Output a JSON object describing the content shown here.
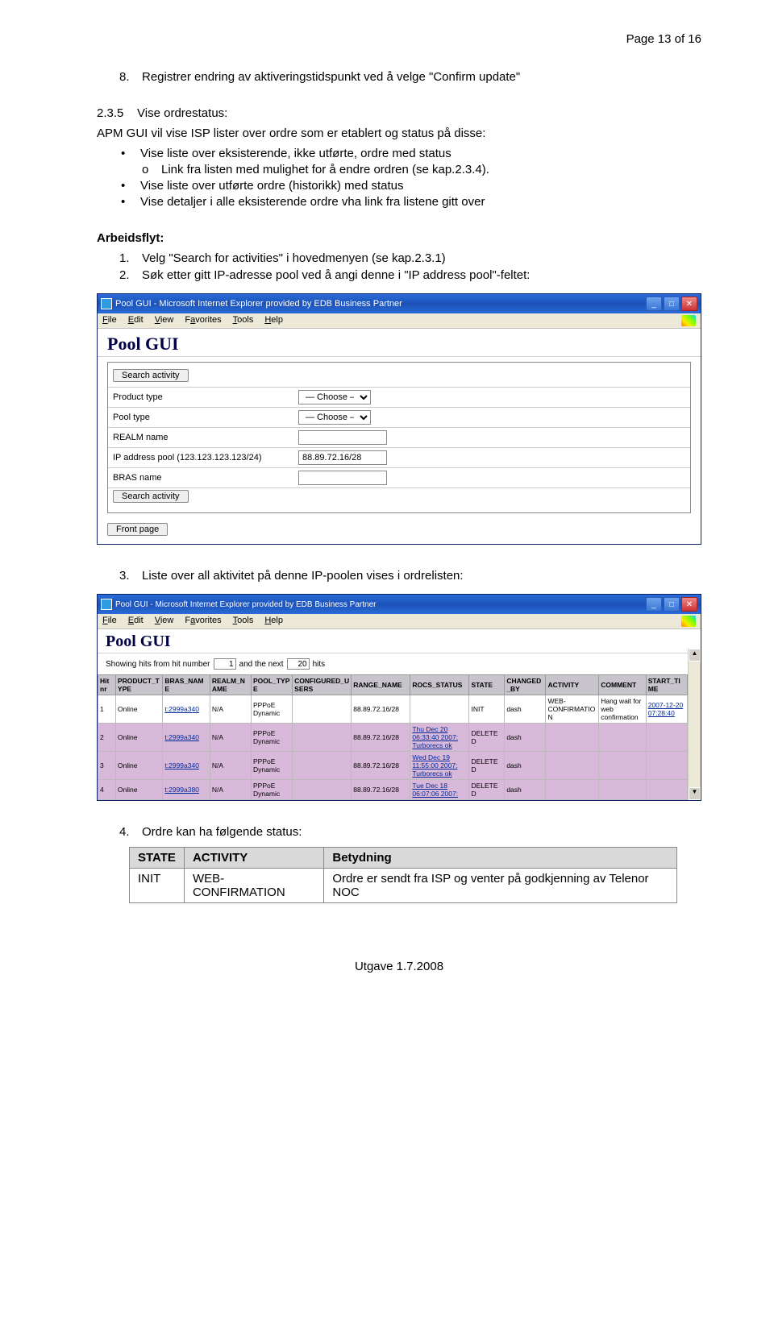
{
  "page_header": "Page 13 of 16",
  "step8": {
    "num": "8.",
    "text": "Registrer endring av aktiveringstidspunkt ved å velge \"Confirm update\""
  },
  "section235": {
    "num": "2.3.5",
    "title": "Vise ordrestatus:",
    "intro": "APM GUI vil vise ISP lister over ordre som er etablert og status på disse:",
    "b1": "Vise liste over eksisterende, ikke utførte, ordre med status",
    "b1s1_circ": "o",
    "b1s1": "Link fra listen med mulighet for å endre ordren (se kap.2.3.4).",
    "b2": "Vise liste over utførte ordre (historikk) med status",
    "b3": "Vise detaljer i alle eksisterende ordre vha link fra listene gitt over"
  },
  "workflow_title": "Arbeidsflyt:",
  "wf1": {
    "num": "1.",
    "text": "Velg \"Search for activities\" i hovedmenyen (se kap.2.3.1)"
  },
  "wf2": {
    "num": "2.",
    "text": "Søk etter gitt IP-adresse pool ved å angi denne i \"IP address pool\"-feltet:"
  },
  "wf3": {
    "num": "3.",
    "text": "Liste over all aktivitet på denne IP-poolen vises i ordrelisten:"
  },
  "wf4": {
    "num": "4.",
    "text": "Ordre kan ha følgende status:"
  },
  "window1": {
    "title": "Pool GUI - Microsoft Internet Explorer provided by EDB Business Partner",
    "menu": {
      "file": "File",
      "edit": "Edit",
      "view": "View",
      "favorites": "Favorites",
      "tools": "Tools",
      "help": "Help"
    },
    "app_title": "Pool GUI",
    "search_btn": "Search activity",
    "rows": {
      "product_type": {
        "label": "Product type",
        "value": "— Choose —"
      },
      "pool_type": {
        "label": "Pool type",
        "value": "— Choose —"
      },
      "realm_name": {
        "label": "REALM name",
        "value": ""
      },
      "ip_pool": {
        "label": "IP address pool (123.123.123.123/24)",
        "value": "88.89.72.16/28"
      },
      "bras_name": {
        "label": "BRAS name",
        "value": ""
      }
    },
    "search_btn2": "Search activity",
    "front_btn": "Front page"
  },
  "window2": {
    "title": "Pool GUI - Microsoft Internet Explorer provided by EDB Business Partner",
    "menu": {
      "file": "File",
      "edit": "Edit",
      "view": "View",
      "favorites": "Favorites",
      "tools": "Tools",
      "help": "Help"
    },
    "app_title": "Pool GUI",
    "hit_prefix": "Showing hits from hit number",
    "hit_from": "1",
    "hit_mid": "and the next",
    "hit_count": "20",
    "hit_suffix": "hits",
    "headers": {
      "hitnr": "Hit nr",
      "product_type": "PRODUCT_TYPE",
      "bras_name": "BRAS_NAME",
      "realm_name": "REALM_NAME",
      "pool_type": "POOL_TYPE",
      "conf_users": "CONFIGURED_USERS",
      "range_name": "RANGE_NAME",
      "rocs_status": "ROCS_STATUS",
      "state": "STATE",
      "changed_by": "CHANGED_BY",
      "activity": "ACTIVITY",
      "comment": "COMMENT",
      "start_time": "START_TIME"
    },
    "rows": [
      {
        "hit": "1",
        "product": "Online",
        "bras": "t:2999a340",
        "realm": "N/A",
        "pool": "PPPoE Dynamic",
        "conf": "",
        "range": "88.89.72.16/28",
        "rocs": "",
        "state": "INIT",
        "changed": "dash",
        "activity": "WEB-CONFIRMATION",
        "comment": "Hang wait for web confirmation",
        "start": "2007-12-20 07:28:40",
        "deleted": false
      },
      {
        "hit": "2",
        "product": "Online",
        "bras": "t:2999a340",
        "realm": "N/A",
        "pool": "PPPoE Dynamic",
        "conf": "",
        "range": "88.89.72.16/28",
        "rocs": "Thu Dec 20 06:33:40 2007: Turborecs ok",
        "state": "DELETED",
        "changed": "dash",
        "activity": "",
        "comment": "",
        "start": "",
        "deleted": true
      },
      {
        "hit": "3",
        "product": "Online",
        "bras": "t:2999a340",
        "realm": "N/A",
        "pool": "PPPoE Dynamic",
        "conf": "",
        "range": "88.89.72.16/28",
        "rocs": "Wed Dec 19 11:55:00 2007: Turborecs ok",
        "state": "DELETED",
        "changed": "dash",
        "activity": "",
        "comment": "",
        "start": "",
        "deleted": true
      },
      {
        "hit": "4",
        "product": "Online",
        "bras": "t:2999a380",
        "realm": "N/A",
        "pool": "PPPoE Dynamic",
        "conf": "",
        "range": "88.89.72.16/28",
        "rocs": "Tue Dec 18 06:07:06 2007:",
        "state": "DELETED",
        "changed": "dash",
        "activity": "",
        "comment": "",
        "start": "",
        "deleted": true
      }
    ]
  },
  "status_table": {
    "h_state": "STATE",
    "h_activity": "ACTIVITY",
    "h_meaning": "Betydning",
    "r1_state": "INIT",
    "r1_activity": "WEB-CONFIRMATION",
    "r1_meaning": "Ordre er sendt fra ISP og venter på godkjenning av Telenor NOC"
  },
  "footer": "Utgave 1.7.2008"
}
